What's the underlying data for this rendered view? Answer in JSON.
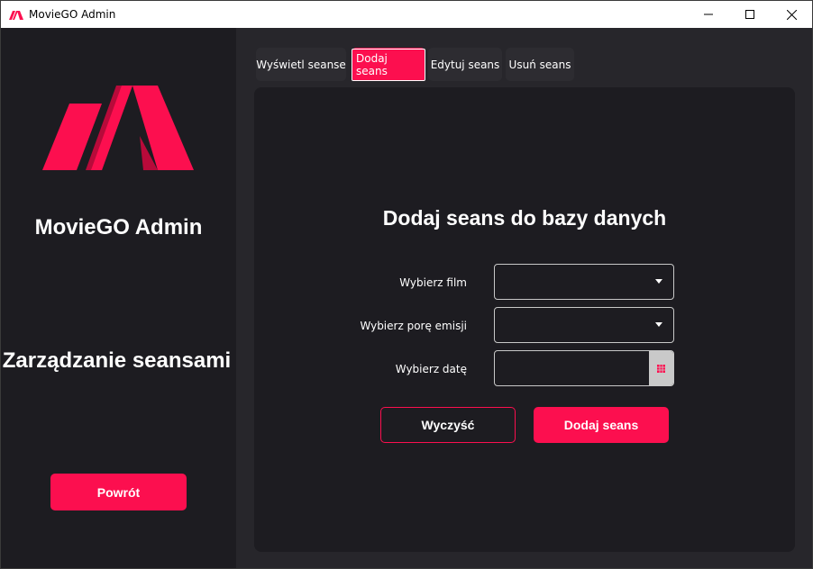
{
  "window": {
    "title": "MovieGO Admin",
    "controls": {
      "minimize_icon": "minimize-icon",
      "maximize_icon": "maximize-icon",
      "close_icon": "close-icon"
    }
  },
  "colors": {
    "accent": "#fc0f4f",
    "sidebar_bg": "#1d1c21",
    "main_bg": "#27262b",
    "panel_bg": "#1d1c21",
    "text": "#ffffff"
  },
  "sidebar": {
    "logo_icon": "moviego-logo",
    "title": "MovieGO Admin",
    "subtitle": "Zarządzanie seansami",
    "back_label": "Powrót"
  },
  "tabs": [
    {
      "label": "Wyświetl seanse",
      "active": false
    },
    {
      "label": "Dodaj seans",
      "active": true
    },
    {
      "label": "Edytuj seans",
      "active": false
    },
    {
      "label": "Usuń seans",
      "active": false
    }
  ],
  "form": {
    "title": "Dodaj seans do bazy danych",
    "movie_label": "Wybierz film",
    "movie_value": "",
    "time_label": "Wybierz porę emisji",
    "time_value": "",
    "date_label": "Wybierz datę",
    "date_value": "",
    "date_icon": "calendar-icon",
    "clear_label": "Wyczyść",
    "submit_label": "Dodaj seans"
  }
}
